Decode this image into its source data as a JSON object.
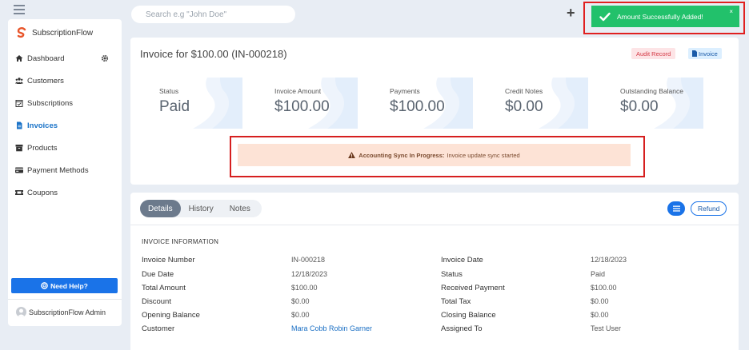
{
  "sidebar": {
    "brand": "SubscriptionFlow",
    "items": [
      {
        "label": "Dashboard",
        "icon": "home-icon"
      },
      {
        "label": "Customers",
        "icon": "users-icon"
      },
      {
        "label": "Subscriptions",
        "icon": "calendar-check-icon"
      },
      {
        "label": "Invoices",
        "icon": "invoice-icon"
      },
      {
        "label": "Products",
        "icon": "box-icon"
      },
      {
        "label": "Payment Methods",
        "icon": "credit-card-icon"
      },
      {
        "label": "Coupons",
        "icon": "ticket-icon"
      }
    ],
    "active_item": "Invoices",
    "help_label": "Need Help?",
    "admin_name": "SubscriptionFlow Admin"
  },
  "search": {
    "placeholder": "Search e.g \"John Doe\""
  },
  "toast": {
    "message": "Amount Successfully Added!",
    "close": "×"
  },
  "invoice": {
    "title": "Invoice for $100.00 (IN-000218)",
    "badges": {
      "audit": "Audit Record",
      "invoice": "Invoice"
    },
    "stats": [
      {
        "label": "Status",
        "value": "Paid"
      },
      {
        "label": "Invoice Amount",
        "value": "$100.00"
      },
      {
        "label": "Payments",
        "value": "$100.00"
      },
      {
        "label": "Credit Notes",
        "value": "$0.00"
      },
      {
        "label": "Outstanding Balance",
        "value": "$0.00"
      }
    ],
    "sync_alert": {
      "title": "Accounting Sync In Progress:",
      "message": "Invoice update sync started"
    }
  },
  "details": {
    "tabs": [
      "Details",
      "History",
      "Notes"
    ],
    "active_tab": "Details",
    "refund_label": "Refund",
    "section_title": "INVOICE INFORMATION",
    "rows": [
      {
        "l1": "Invoice Number",
        "v1": "IN-000218",
        "l2": "Invoice Date",
        "v2": "12/18/2023"
      },
      {
        "l1": "Due Date",
        "v1": "12/18/2023",
        "l2": "Status",
        "v2": "Paid"
      },
      {
        "l1": "Total Amount",
        "v1": "$100.00",
        "l2": "Received Payment",
        "v2": "$100.00"
      },
      {
        "l1": "Discount",
        "v1": "$0.00",
        "l2": "Total Tax",
        "v2": "$0.00"
      },
      {
        "l1": "Opening Balance",
        "v1": "$0.00",
        "l2": "Closing Balance",
        "v2": "$0.00"
      },
      {
        "l1": "Customer",
        "v1": "Mara Cobb Robin Garner",
        "l2": "Assigned To",
        "v2": "Test User"
      }
    ]
  },
  "colors": {
    "accent": "#1a73e8",
    "success": "#22c16b",
    "highlight_frame": "#e02020",
    "alert_bg": "#fde3d6",
    "page_bg": "#e8edf4"
  }
}
